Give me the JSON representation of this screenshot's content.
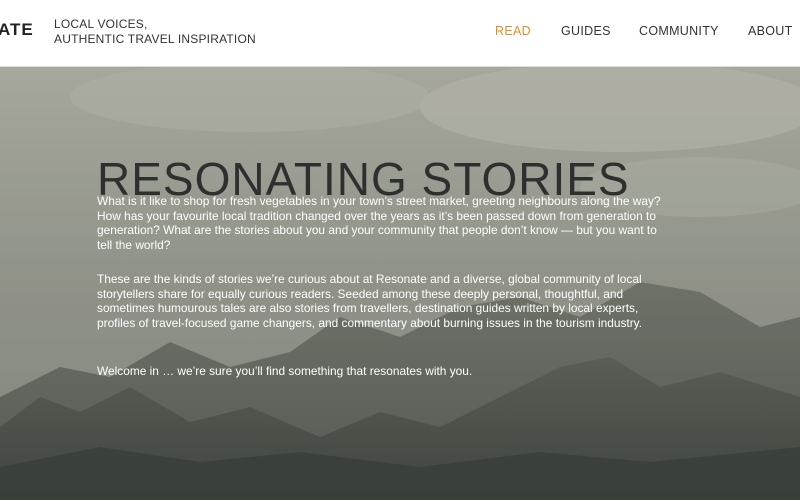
{
  "header": {
    "logo": "ATE",
    "tagline": [
      "LOCAL VOICES,",
      "AUTHENTIC TRAVEL INSPIRATION"
    ],
    "nav": [
      {
        "label": "READ",
        "active": true
      },
      {
        "label": "GUIDES",
        "active": false
      },
      {
        "label": "COMMUNITY",
        "active": false
      },
      {
        "label": "ABOUT",
        "active": false
      }
    ],
    "accent_color": "#e0902a"
  },
  "hero": {
    "title": "RESONATING STORIES",
    "paragraphs": [
      "What is it like to shop for fresh vegetables in your town’s street market, greeting neighbours along the way? How has your favourite local tradition changed over the years as it’s been passed down from generation to generation? What are the stories about you and your community that people don’t know — but you want to tell the world?",
      "These are the kinds of stories we’re curious about at Resonate and a diverse, global community of local storytellers share for equally curious readers. Seeded among these deeply personal, thoughtful, and sometimes humourous tales are also stories from travellers, destination guides written by local experts, profiles of travel-focused game changers, and commentary about burning issues in the tourism industry.",
      "Welcome in … we’re sure you’ll find something that resonates with you."
    ]
  }
}
